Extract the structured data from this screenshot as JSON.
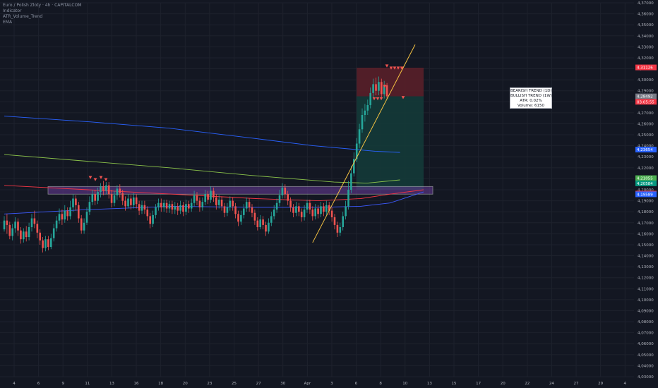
{
  "header": {
    "symbol_line": "Euro / Polish Zloty · 4h · CAPITALCOM",
    "indicators": [
      "Indicator",
      "ATR_Volume_Trend",
      "EMA"
    ]
  },
  "info_box": {
    "line1": "BEARISH TREND (1D)",
    "line2": "BULLISH TREND (1W)",
    "line3": "ATR: 0.02%",
    "line4": "Volume: 6150"
  },
  "colors": {
    "background": "#131722",
    "up": "#26a69a",
    "down": "#ef5350",
    "grid": "#1e222d",
    "axis_text": "#b2b5be",
    "ema_blue_long": "#2962ff",
    "ema_green": "#8bc34a",
    "ema_red": "#f23645",
    "ema_blue_short": "#3d5afe",
    "trendline": "#f5c242",
    "zone_fill": "#6a3d9a",
    "zone_border": "#e0e0e0",
    "stop_zone": "#5d2029",
    "target_zone": "#143c3a"
  },
  "chart_data": {
    "type": "candlestick",
    "y_axis": {
      "min": 4.03,
      "max": 4.37,
      "ticks": [
        "4,37000",
        "4,36000",
        "4,35000",
        "4,34000",
        "4,33000",
        "4,32000",
        "4,31000",
        "4,30000",
        "4,29000",
        "4,28000",
        "4,27000",
        "4,26000",
        "4,25000",
        "4,24000",
        "4,23000",
        "4,22000",
        "4,21000",
        "4,20000",
        "4,19000",
        "4,18000",
        "4,17000",
        "4,16000",
        "4,15000",
        "4,14000",
        "4,13000",
        "4,12000",
        "4,11000",
        "4,10000",
        "4,09000",
        "4,08000",
        "4,07000",
        "4,06000",
        "4,05000",
        "4,04000",
        "4,03000"
      ]
    },
    "x_axis": {
      "ticks": [
        "4",
        "6",
        "9",
        "11",
        "13",
        "16",
        "18",
        "20",
        "23",
        "25",
        "27",
        "30",
        "Apr",
        "3",
        "6",
        "8",
        "10",
        "13",
        "15",
        "17",
        "20",
        "22",
        "24",
        "27",
        "29",
        "4"
      ]
    },
    "price_labels": [
      {
        "value": 4.31126,
        "text": "4,31126",
        "color": "#f23645"
      },
      {
        "value": 4.28492,
        "text": "4,28492",
        "color": "#787b86"
      },
      {
        "value": 4.28,
        "text": "03:05:55",
        "color": "#f23645"
      },
      {
        "value": 4.23654,
        "text": "4,23654",
        "color": "#2962ff"
      },
      {
        "value": 4.21055,
        "text": "4,21055",
        "color": "#4caf50"
      },
      {
        "value": 4.20584,
        "text": "4,20584",
        "color": "#089981"
      },
      {
        "value": 4.19651,
        "text": "4,19651",
        "color": "#f23645"
      },
      {
        "value": 4.19589,
        "text": "4,19589",
        "color": "#2962ff"
      }
    ],
    "candles": [
      [
        4.164,
        4.172,
        4.176,
        4.162
      ],
      [
        4.172,
        4.168,
        4.178,
        4.16
      ],
      [
        4.168,
        4.158,
        4.171,
        4.155
      ],
      [
        4.158,
        4.165,
        4.169,
        4.154
      ],
      [
        4.165,
        4.171,
        4.175,
        4.161
      ],
      [
        4.171,
        4.163,
        4.174,
        4.158
      ],
      [
        4.163,
        4.155,
        4.166,
        4.151
      ],
      [
        4.155,
        4.162,
        4.165,
        4.152
      ],
      [
        4.162,
        4.157,
        4.167,
        4.153
      ],
      [
        4.157,
        4.166,
        4.17,
        4.154
      ],
      [
        4.166,
        4.174,
        4.178,
        4.162
      ],
      [
        4.174,
        4.169,
        4.181,
        4.165
      ],
      [
        4.169,
        4.161,
        4.172,
        4.156
      ],
      [
        4.161,
        4.154,
        4.164,
        4.15
      ],
      [
        4.154,
        4.147,
        4.157,
        4.143
      ],
      [
        4.147,
        4.155,
        4.158,
        4.144
      ],
      [
        4.155,
        4.148,
        4.158,
        4.145
      ],
      [
        4.148,
        4.156,
        4.16,
        4.146
      ],
      [
        4.156,
        4.165,
        4.169,
        4.153
      ],
      [
        4.165,
        4.172,
        4.176,
        4.162
      ],
      [
        4.172,
        4.178,
        4.183,
        4.169
      ],
      [
        4.178,
        4.173,
        4.182,
        4.168
      ],
      [
        4.173,
        4.181,
        4.186,
        4.17
      ],
      [
        4.181,
        4.176,
        4.184,
        4.172
      ],
      [
        4.176,
        4.184,
        4.19,
        4.173
      ],
      [
        4.184,
        4.192,
        4.196,
        4.18
      ],
      [
        4.192,
        4.186,
        4.195,
        4.181
      ],
      [
        4.186,
        4.174,
        4.189,
        4.17
      ],
      [
        4.174,
        4.163,
        4.177,
        4.16
      ],
      [
        4.163,
        4.17,
        4.174,
        4.16
      ],
      [
        4.17,
        4.18,
        4.184,
        4.168
      ],
      [
        4.18,
        4.189,
        4.194,
        4.177
      ],
      [
        4.189,
        4.196,
        4.2,
        4.186
      ],
      [
        4.196,
        4.19,
        4.2,
        4.186
      ],
      [
        4.19,
        4.198,
        4.202,
        4.187
      ],
      [
        4.198,
        4.203,
        4.206,
        4.193
      ],
      [
        4.203,
        4.199,
        4.208,
        4.195
      ],
      [
        4.199,
        4.204,
        4.207,
        4.196
      ],
      [
        4.204,
        4.196,
        4.207,
        4.192
      ],
      [
        4.196,
        4.188,
        4.2,
        4.184
      ],
      [
        4.188,
        4.195,
        4.199,
        4.185
      ],
      [
        4.195,
        4.201,
        4.204,
        4.191
      ],
      [
        4.201,
        4.197,
        4.205,
        4.193
      ],
      [
        4.197,
        4.19,
        4.2,
        4.186
      ],
      [
        4.19,
        4.185,
        4.194,
        4.181
      ],
      [
        4.185,
        4.192,
        4.196,
        4.183
      ],
      [
        4.192,
        4.186,
        4.195,
        4.182
      ],
      [
        4.186,
        4.193,
        4.197,
        4.183
      ],
      [
        4.193,
        4.187,
        4.196,
        4.183
      ],
      [
        4.187,
        4.181,
        4.19,
        4.177
      ],
      [
        4.181,
        4.186,
        4.19,
        4.178
      ],
      [
        4.186,
        4.182,
        4.19,
        4.178
      ],
      [
        4.182,
        4.176,
        4.185,
        4.172
      ],
      [
        4.176,
        4.169,
        4.179,
        4.165
      ],
      [
        4.169,
        4.177,
        4.181,
        4.166
      ],
      [
        4.177,
        4.184,
        4.187,
        4.174
      ],
      [
        4.184,
        4.188,
        4.192,
        4.181
      ],
      [
        4.188,
        4.184,
        4.192,
        4.18
      ],
      [
        4.184,
        4.188,
        4.191,
        4.18
      ],
      [
        4.188,
        4.183,
        4.191,
        4.179
      ],
      [
        4.183,
        4.187,
        4.19,
        4.179
      ],
      [
        4.187,
        4.182,
        4.19,
        4.178
      ],
      [
        4.182,
        4.185,
        4.189,
        4.178
      ],
      [
        4.185,
        4.181,
        4.188,
        4.177
      ],
      [
        4.181,
        4.186,
        4.19,
        4.178
      ],
      [
        4.186,
        4.18,
        4.189,
        4.176
      ],
      [
        4.18,
        4.187,
        4.191,
        4.177
      ],
      [
        4.187,
        4.183,
        4.19,
        4.179
      ],
      [
        4.183,
        4.188,
        4.192,
        4.18
      ],
      [
        4.188,
        4.195,
        4.199,
        4.185
      ],
      [
        4.195,
        4.19,
        4.198,
        4.186
      ],
      [
        4.19,
        4.184,
        4.193,
        4.18
      ],
      [
        4.184,
        4.189,
        4.193,
        4.181
      ],
      [
        4.189,
        4.196,
        4.2,
        4.186
      ],
      [
        4.196,
        4.191,
        4.199,
        4.187
      ],
      [
        4.191,
        4.199,
        4.203,
        4.188
      ],
      [
        4.199,
        4.193,
        4.202,
        4.189
      ],
      [
        4.193,
        4.186,
        4.196,
        4.182
      ],
      [
        4.186,
        4.191,
        4.195,
        4.183
      ],
      [
        4.191,
        4.185,
        4.194,
        4.181
      ],
      [
        4.185,
        4.179,
        4.188,
        4.175
      ],
      [
        4.179,
        4.184,
        4.188,
        4.176
      ],
      [
        4.184,
        4.19,
        4.194,
        4.181
      ],
      [
        4.19,
        4.185,
        4.193,
        4.181
      ],
      [
        4.185,
        4.178,
        4.188,
        4.174
      ],
      [
        4.178,
        4.171,
        4.181,
        4.167
      ],
      [
        4.171,
        4.177,
        4.181,
        4.168
      ],
      [
        4.177,
        4.183,
        4.187,
        4.174
      ],
      [
        4.183,
        4.189,
        4.193,
        4.18
      ],
      [
        4.189,
        4.184,
        4.192,
        4.18
      ],
      [
        4.184,
        4.179,
        4.187,
        4.175
      ],
      [
        4.179,
        4.172,
        4.182,
        4.168
      ],
      [
        4.172,
        4.166,
        4.175,
        4.163
      ],
      [
        4.166,
        4.173,
        4.177,
        4.164
      ],
      [
        4.173,
        4.168,
        4.176,
        4.164
      ],
      [
        4.168,
        4.162,
        4.171,
        4.158
      ],
      [
        4.162,
        4.17,
        4.174,
        4.16
      ],
      [
        4.17,
        4.176,
        4.18,
        4.167
      ],
      [
        4.176,
        4.182,
        4.186,
        4.173
      ],
      [
        4.182,
        4.188,
        4.192,
        4.179
      ],
      [
        4.188,
        4.195,
        4.2,
        4.185
      ],
      [
        4.195,
        4.202,
        4.206,
        4.192
      ],
      [
        4.202,
        4.196,
        4.205,
        4.192
      ],
      [
        4.196,
        4.19,
        4.199,
        4.186
      ],
      [
        4.19,
        4.184,
        4.193,
        4.18
      ],
      [
        4.184,
        4.179,
        4.187,
        4.175
      ],
      [
        4.179,
        4.185,
        4.189,
        4.176
      ],
      [
        4.185,
        4.18,
        4.188,
        4.176
      ],
      [
        4.18,
        4.175,
        4.183,
        4.171
      ],
      [
        4.175,
        4.182,
        4.186,
        4.172
      ],
      [
        4.182,
        4.188,
        4.191,
        4.179
      ],
      [
        4.188,
        4.182,
        4.191,
        4.178
      ],
      [
        4.182,
        4.176,
        4.185,
        4.172
      ],
      [
        4.176,
        4.183,
        4.187,
        4.173
      ],
      [
        4.183,
        4.178,
        4.186,
        4.174
      ],
      [
        4.178,
        4.185,
        4.189,
        4.175
      ],
      [
        4.185,
        4.18,
        4.188,
        4.176
      ],
      [
        4.18,
        4.186,
        4.19,
        4.177
      ],
      [
        4.186,
        4.181,
        4.189,
        4.177
      ],
      [
        4.181,
        4.175,
        4.184,
        4.171
      ],
      [
        4.175,
        4.168,
        4.178,
        4.164
      ],
      [
        4.168,
        4.161,
        4.171,
        4.157
      ],
      [
        4.161,
        4.166,
        4.17,
        4.158
      ],
      [
        4.166,
        4.176,
        4.18,
        4.163
      ],
      [
        4.176,
        4.185,
        4.19,
        4.173
      ],
      [
        4.185,
        4.2,
        4.208,
        4.182
      ],
      [
        4.2,
        4.215,
        4.222,
        4.197
      ],
      [
        4.215,
        4.228,
        4.234,
        4.212
      ],
      [
        4.228,
        4.242,
        4.247,
        4.225
      ],
      [
        4.242,
        4.255,
        4.26,
        4.238
      ],
      [
        4.255,
        4.268,
        4.274,
        4.252
      ],
      [
        4.268,
        4.272,
        4.278,
        4.262
      ],
      [
        4.272,
        4.277,
        4.282,
        4.268
      ],
      [
        4.277,
        4.288,
        4.293,
        4.274
      ],
      [
        4.288,
        4.296,
        4.301,
        4.284
      ],
      [
        4.296,
        4.29,
        4.302,
        4.286
      ],
      [
        4.29,
        4.298,
        4.303,
        4.286
      ],
      [
        4.298,
        4.287,
        4.301,
        4.283
      ],
      [
        4.287,
        4.295,
        4.299,
        4.283
      ],
      [
        4.295,
        4.285,
        4.297,
        4.282
      ]
    ],
    "ema_blue_long": [
      [
        0,
        4.267
      ],
      [
        0.2,
        4.262
      ],
      [
        0.4,
        4.256
      ],
      [
        0.6,
        4.247
      ],
      [
        0.75,
        4.24
      ],
      [
        0.9,
        4.235
      ],
      [
        0.96,
        4.234
      ]
    ],
    "ema_green": [
      [
        0,
        4.232
      ],
      [
        0.2,
        4.226
      ],
      [
        0.4,
        4.22
      ],
      [
        0.6,
        4.213
      ],
      [
        0.8,
        4.207
      ],
      [
        0.88,
        4.206
      ],
      [
        0.96,
        4.209
      ]
    ],
    "ema_red": [
      [
        0,
        4.204
      ],
      [
        0.2,
        4.2
      ],
      [
        0.4,
        4.196
      ],
      [
        0.6,
        4.192
      ],
      [
        0.75,
        4.19
      ],
      [
        0.85,
        4.192
      ],
      [
        0.92,
        4.196
      ],
      [
        1.0,
        4.2
      ]
    ],
    "ema_blue_short": [
      [
        0,
        4.178
      ],
      [
        0.2,
        4.182
      ],
      [
        0.4,
        4.185
      ],
      [
        0.6,
        4.184
      ],
      [
        0.75,
        4.184
      ],
      [
        0.85,
        4.185
      ],
      [
        0.92,
        4.188
      ],
      [
        1.0,
        4.198
      ]
    ],
    "zone": {
      "top": 4.203,
      "bottom": 4.196
    },
    "stop_zone": {
      "top": 4.311,
      "bottom": 4.285
    },
    "target_zone": {
      "top": 4.285,
      "bottom": 4.2
    },
    "trendline": [
      [
        4.152
      ],
      [
        4.332
      ]
    ],
    "sell_markers": [
      {
        "value": 4.206,
        "count": 4
      },
      {
        "value": 4.31,
        "count": 5
      },
      {
        "value": 4.275,
        "count": 3
      },
      {
        "value": 4.28,
        "count": 2
      }
    ]
  }
}
